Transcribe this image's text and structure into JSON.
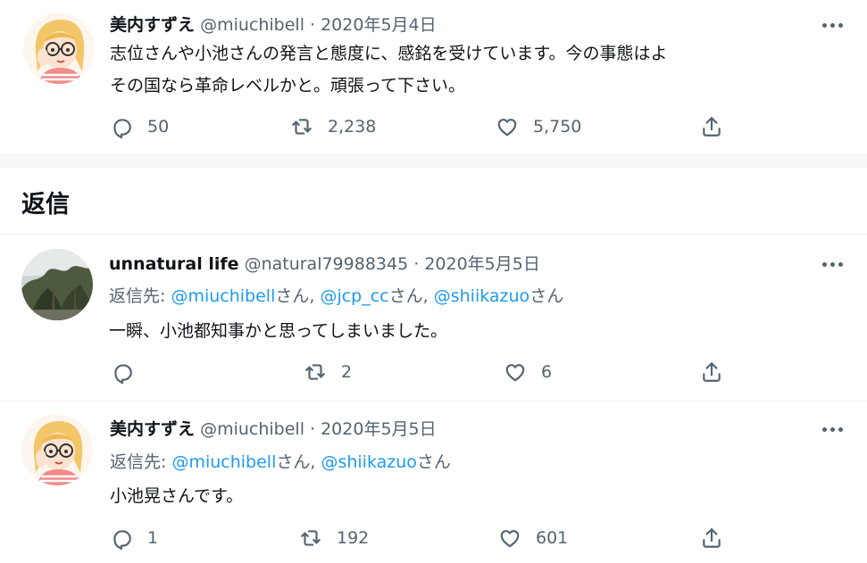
{
  "tweets": [
    {
      "name": "美内すずえ",
      "handle": "@miuchibell",
      "date": "2020年5月4日",
      "text_line1": "志位さんや小池さんの発言と態度に、感銘を受けています。今の事態はよ",
      "text_line2": "その国なら革命レベルかと。頑張って下さい。",
      "replies": "50",
      "retweets": "2,238",
      "likes": "5,750"
    },
    {
      "name": "unnatural life",
      "handle": "@natural79988345",
      "date": "2020年5月5日",
      "reply_to_label": "返信先: ",
      "reply_to": [
        "@miuchibell",
        "@jcp_cc",
        "@shiikazuo"
      ],
      "reply_sep": [
        "さん, ",
        "さん, ",
        "さん"
      ],
      "text_line1": "一瞬、小池都知事かと思ってしまいました。",
      "replies": "",
      "retweets": "2",
      "likes": "6"
    },
    {
      "name": "美内すずえ",
      "handle": "@miuchibell",
      "date": "2020年5月5日",
      "reply_to_label": "返信先: ",
      "reply_to": [
        "@miuchibell",
        "@shiikazuo"
      ],
      "reply_sep": [
        "さん, ",
        "さん"
      ],
      "text_line1": "小池晃さんです。",
      "replies": "1",
      "retweets": "192",
      "likes": "601"
    }
  ],
  "section": {
    "title": "返信"
  },
  "separator": " · ",
  "icons": {
    "reply": "reply-icon",
    "retweet": "retweet-icon",
    "like": "heart-icon",
    "share": "share-icon",
    "more": "more-options-icon"
  },
  "colors": {
    "link": "#1d9bf0",
    "muted": "#536471",
    "text": "#0f1419"
  }
}
